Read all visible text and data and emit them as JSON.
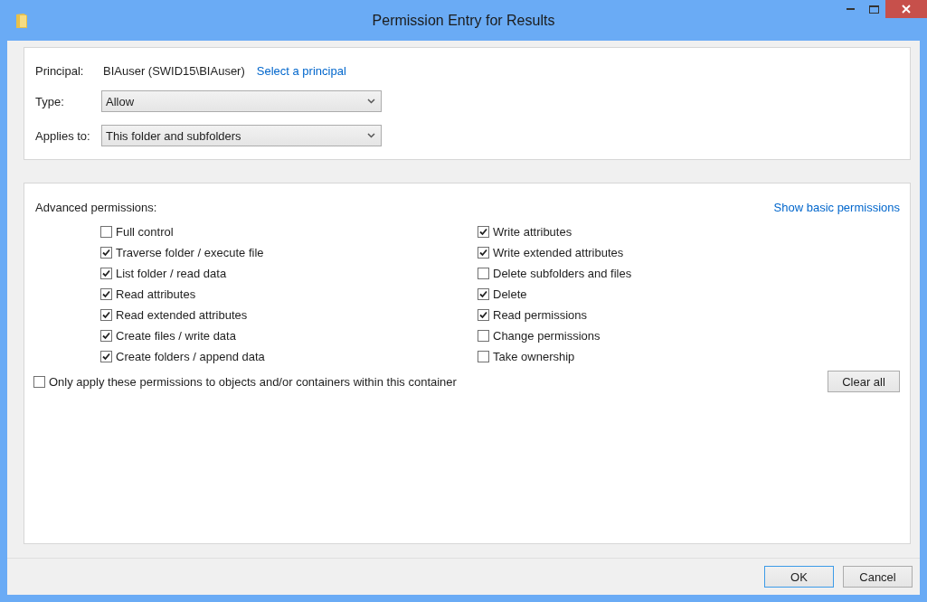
{
  "window": {
    "title": "Permission Entry for Results"
  },
  "principal": {
    "label": "Principal:",
    "value": "BIAuser (SWID15\\BIAuser)",
    "link": "Select a principal"
  },
  "type": {
    "label": "Type:",
    "value": "Allow"
  },
  "applies_to": {
    "label": "Applies to:",
    "value": "This folder and subfolders"
  },
  "advanced": {
    "heading": "Advanced permissions:",
    "toggle_link": "Show basic permissions",
    "columns": [
      [
        {
          "label": "Full control",
          "checked": false
        },
        {
          "label": "Traverse folder / execute file",
          "checked": true
        },
        {
          "label": "List folder / read data",
          "checked": true
        },
        {
          "label": "Read attributes",
          "checked": true
        },
        {
          "label": "Read extended attributes",
          "checked": true
        },
        {
          "label": "Create files / write data",
          "checked": true
        },
        {
          "label": "Create folders / append data",
          "checked": true
        }
      ],
      [
        {
          "label": "Write attributes",
          "checked": true
        },
        {
          "label": "Write extended attributes",
          "checked": true
        },
        {
          "label": "Delete subfolders and files",
          "checked": false
        },
        {
          "label": "Delete",
          "checked": true
        },
        {
          "label": "Read permissions",
          "checked": true
        },
        {
          "label": "Change permissions",
          "checked": false
        },
        {
          "label": "Take ownership",
          "checked": false
        }
      ]
    ],
    "only_apply": {
      "label": "Only apply these permissions to objects and/or containers within this container",
      "checked": false
    },
    "clear_button": "Clear all"
  },
  "buttons": [
    {
      "label": "OK",
      "default": true
    },
    {
      "label": "Cancel",
      "default": false
    }
  ]
}
